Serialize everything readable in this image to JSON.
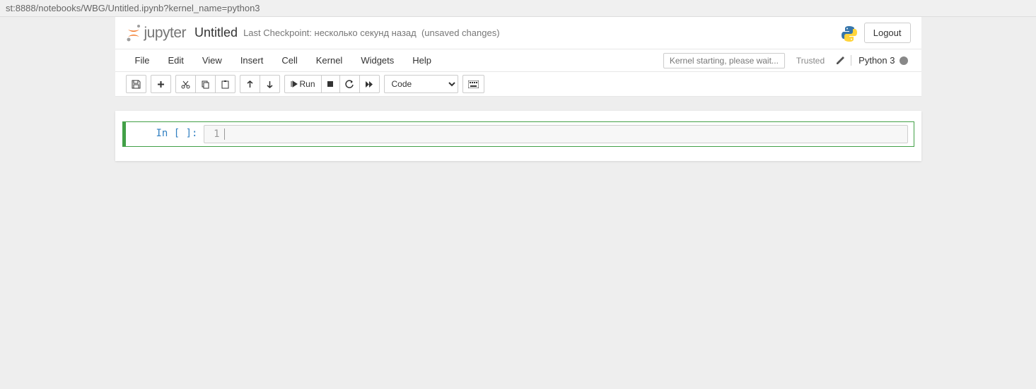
{
  "url": "st:8888/notebooks/WBG/Untitled.ipynb?kernel_name=python3",
  "header": {
    "logo_text": "jupyter",
    "title": "Untitled",
    "checkpoint_prefix": "Last Checkpoint: ",
    "checkpoint_time": "несколько секунд назад",
    "checkpoint_status": "(unsaved changes)",
    "logout_label": "Logout"
  },
  "menubar": {
    "items": {
      "file": "File",
      "edit": "Edit",
      "view": "View",
      "insert": "Insert",
      "cell": "Cell",
      "kernel": "Kernel",
      "widgets": "Widgets",
      "help": "Help"
    },
    "notification": "Kernel starting, please wait...",
    "trusted": "Trusted",
    "kernel_name": "Python 3"
  },
  "toolbar": {
    "run_label": "Run",
    "cell_type": "Code"
  },
  "cell": {
    "prompt": "In [ ]:",
    "line_number": "1",
    "content": ""
  }
}
